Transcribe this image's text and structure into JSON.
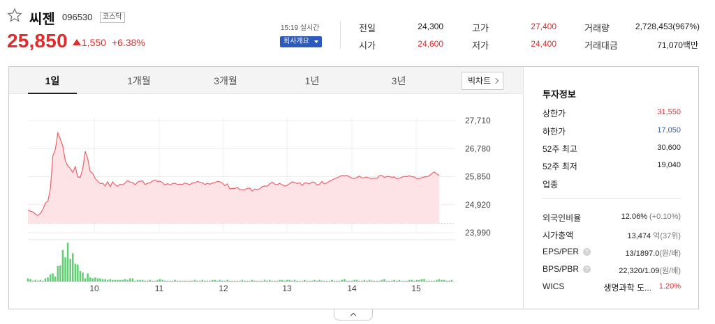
{
  "stock": {
    "name": "씨젠",
    "code": "096530",
    "market": "코스닥",
    "price": "25,850",
    "change": "1,550",
    "change_pct": "+6.38%",
    "realtime": "15:19 실시간",
    "company_btn": "회사개요"
  },
  "quotes": {
    "prev_close": {
      "label": "전일",
      "value": "24,300"
    },
    "open": {
      "label": "시가",
      "value": "24,600"
    },
    "high": {
      "label": "고가",
      "value": "27,400"
    },
    "low": {
      "label": "저가",
      "value": "24,400"
    },
    "volume": {
      "label": "거래량",
      "value": "2,728,453(967%)"
    },
    "amount": {
      "label": "거래대금",
      "value": "71,070백만"
    }
  },
  "tabs": [
    "1일",
    "1개월",
    "3개월",
    "1년",
    "3년"
  ],
  "bigchart_label": "빅차트",
  "info": {
    "title": "투자정보",
    "upper_limit": {
      "label": "상한가",
      "value": "31,550"
    },
    "lower_limit": {
      "label": "하한가",
      "value": "17,050"
    },
    "high_52w": {
      "label": "52주 최고",
      "value": "30,600"
    },
    "low_52w": {
      "label": "52주 최저",
      "value": "19,040"
    },
    "sector": {
      "label": "업종",
      "value": ""
    },
    "foreign_ratio": {
      "label": "외국인비율",
      "value": "12.06%",
      "sub": "(+0.10%)"
    },
    "market_cap": {
      "label": "시가총액",
      "value": "13,474",
      "sub": "억(37위)"
    },
    "eps_per": {
      "label": "EPS/PER",
      "value": "13/1897.0",
      "sub": "(원/배)"
    },
    "bps_pbr": {
      "label": "BPS/PBR",
      "value": "22,320/1.09",
      "sub": "(원/배)"
    },
    "wics": {
      "label": "WICS",
      "sector": "생명과학 도...",
      "pct": "1.20%"
    }
  },
  "colors": {
    "up": "#e22b2b",
    "down": "#2d5bbd",
    "volume": "#5fcf74",
    "line": "#f0606a",
    "fill": "#fde3e5"
  },
  "chart_data": {
    "type": "area",
    "title": "",
    "x_ticks": [
      "10",
      "11",
      "12",
      "13",
      "14",
      "15"
    ],
    "y_ticks": [
      "27,710",
      "26,780",
      "25,850",
      "24,920",
      "23,990"
    ],
    "ylim": [
      23990,
      27710
    ],
    "prev_close": 24300,
    "grid": true,
    "price": [
      24750,
      24700,
      24680,
      24610,
      24560,
      24630,
      24760,
      24980,
      25040,
      25440,
      26540,
      26760,
      27300,
      27100,
      26860,
      26380,
      26210,
      26120,
      25990,
      26180,
      25840,
      25830,
      26110,
      26690,
      26440,
      26020,
      25960,
      25790,
      25700,
      25620,
      25630,
      25540,
      25680,
      25520,
      25680,
      25580,
      25530,
      25600,
      25570,
      25640,
      25720,
      25670,
      25660,
      25580,
      25670,
      25700,
      25710,
      25590,
      25630,
      25650,
      25710,
      25740,
      25690,
      25700,
      25650,
      25570,
      25620,
      25570,
      25620,
      25630,
      25590,
      25600,
      25590,
      25640,
      25610,
      25590,
      25640,
      25650,
      25690,
      25660,
      25650,
      25590,
      25630,
      25600,
      25640,
      25650,
      25690,
      25680,
      25640,
      25550,
      25610,
      25440,
      25460,
      25460,
      25490,
      25420,
      25410,
      25420,
      25460,
      25470,
      25370,
      25440,
      25420,
      25450,
      25520,
      25540,
      25530,
      25610,
      25670,
      25600,
      25580,
      25630,
      25580,
      25540,
      25560,
      25620,
      25680,
      25660,
      25620,
      25650,
      25560,
      25640,
      25640,
      25610,
      25670,
      25660,
      25570,
      25600,
      25690,
      25610,
      25650,
      25700,
      25740,
      25780,
      25810,
      25850,
      25890,
      25880,
      25890,
      25840,
      25800,
      25790,
      25820,
      25870,
      25800,
      25820,
      25830,
      25800,
      25790,
      25800,
      25790,
      25880,
      25890,
      25820,
      25860,
      25850,
      25830,
      25840,
      25780,
      25800,
      25830,
      25860,
      25850,
      25880,
      25850,
      25840,
      25780,
      25790,
      25810,
      25840,
      25850,
      25880,
      25950,
      26010,
      25940,
      25890
    ],
    "volume": [
      4,
      3,
      1,
      2,
      1,
      2,
      1,
      4,
      5,
      9,
      10,
      6,
      19,
      20,
      39,
      30,
      48,
      28,
      35,
      22,
      21,
      13,
      11,
      4,
      10,
      5,
      4,
      5,
      4,
      4,
      3,
      3,
      2,
      3,
      2,
      2,
      2,
      2,
      2,
      3,
      2,
      4,
      4,
      1,
      2,
      2,
      2,
      1,
      1,
      2,
      1,
      1,
      2,
      3,
      2,
      1,
      1,
      1,
      1,
      2,
      1,
      1,
      1,
      1,
      1,
      1,
      1,
      2,
      1,
      1,
      2,
      1,
      1,
      1,
      2,
      2,
      1,
      2,
      1,
      1,
      2,
      1,
      1,
      1,
      1,
      1,
      2,
      1,
      1,
      1,
      2,
      1,
      1,
      1,
      1,
      2,
      1,
      2,
      1,
      1,
      1,
      2,
      2,
      1,
      2,
      2,
      1,
      2,
      1,
      1,
      1,
      2,
      1,
      1,
      1,
      2,
      1,
      2,
      1,
      1,
      1,
      1,
      2,
      1,
      1,
      1,
      2,
      3,
      1,
      1,
      1,
      2,
      2,
      1,
      1,
      2,
      1,
      2,
      1,
      1,
      1,
      1,
      2,
      3,
      1,
      1,
      1,
      2,
      1,
      2,
      1,
      1,
      1,
      2,
      2,
      1,
      2,
      2,
      3,
      3,
      1,
      1,
      1,
      1,
      2,
      3,
      2,
      2,
      1,
      1,
      2
    ]
  }
}
